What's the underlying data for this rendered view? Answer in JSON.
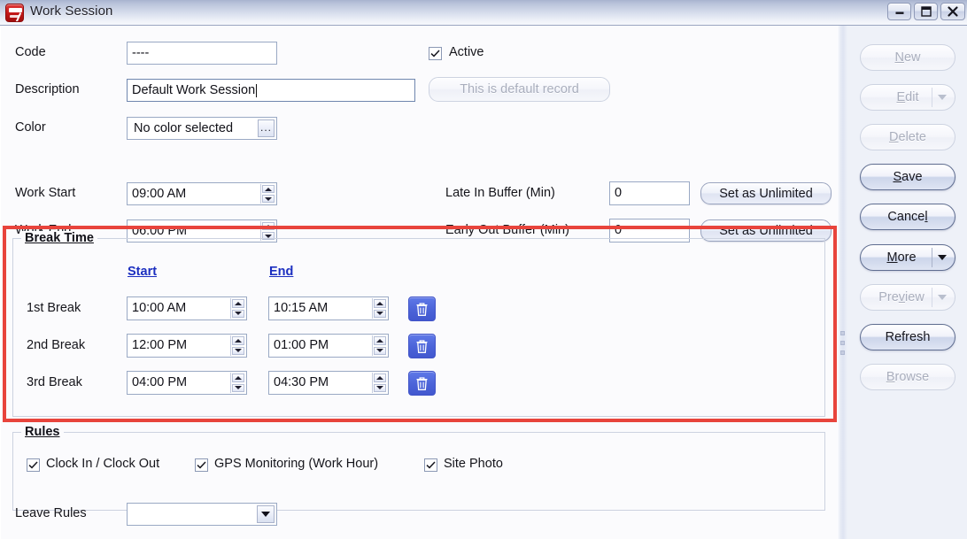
{
  "window": {
    "title": "Work Session",
    "app_icon": "app-logo-icon",
    "controls": {
      "minimize": "minimize-icon",
      "maximize": "maximize-icon",
      "close": "close-icon"
    }
  },
  "form": {
    "fields": {
      "code": {
        "label": "Code",
        "value": "----"
      },
      "description": {
        "label": "Description",
        "value": "Default Work Session"
      },
      "color": {
        "label": "Color",
        "value": "No color selected",
        "browse_label": "..."
      },
      "work_start": {
        "label": "Work Start",
        "value": "09:00 AM"
      },
      "work_end": {
        "label": "Work End",
        "value": "06:00 PM"
      },
      "late_in_buffer": {
        "label": "Late In Buffer (Min)",
        "value": "0",
        "button": "Set as Unlimited"
      },
      "early_out_buffer": {
        "label": "Early Out Buffer (Min)",
        "value": "0",
        "button": "Set as Unlimited"
      }
    },
    "active": {
      "label": "Active",
      "checked": true
    },
    "default_record_button": {
      "label": "This is default record",
      "enabled": false
    }
  },
  "break_time": {
    "title": "Break Time",
    "columns": {
      "start": "Start",
      "end": "End"
    },
    "rows": [
      {
        "label": "1st Break",
        "start": "10:00 AM",
        "end": "10:15 AM",
        "delete": "delete-icon"
      },
      {
        "label": "2nd Break",
        "start": "12:00 PM",
        "end": "01:00 PM",
        "delete": "delete-icon"
      },
      {
        "label": "3rd Break",
        "start": "04:00 PM",
        "end": "04:30 PM",
        "delete": "delete-icon"
      }
    ],
    "highlight_color": "#e8443c"
  },
  "rules": {
    "title": "Rules",
    "items": [
      {
        "label": "Clock In / Clock Out",
        "checked": true
      },
      {
        "label": "GPS Monitoring (Work Hour)",
        "checked": true
      },
      {
        "label": "Site Photo",
        "checked": true
      }
    ]
  },
  "leave_rules": {
    "label": "Leave Rules",
    "value": ""
  },
  "sidebar": {
    "buttons": [
      {
        "id": "new",
        "label": "New",
        "mnemonic": "N",
        "enabled": false,
        "dropdown": false
      },
      {
        "id": "edit",
        "label": "Edit",
        "mnemonic": "E",
        "enabled": false,
        "dropdown": true
      },
      {
        "id": "delete",
        "label": "Delete",
        "mnemonic": "D",
        "enabled": false,
        "dropdown": false
      },
      {
        "id": "save",
        "label": "Save",
        "mnemonic": "S",
        "enabled": true,
        "dropdown": false
      },
      {
        "id": "cancel",
        "label": "Cancel",
        "mnemonic": "l",
        "enabled": true,
        "dropdown": false
      },
      {
        "id": "more",
        "label": "More",
        "mnemonic": "M",
        "enabled": true,
        "dropdown": true
      },
      {
        "id": "preview",
        "label": "Preview",
        "mnemonic": "v",
        "enabled": false,
        "dropdown": true
      },
      {
        "id": "refresh",
        "label": "Refresh",
        "mnemonic": "",
        "enabled": true,
        "dropdown": false
      },
      {
        "id": "browse",
        "label": "Browse",
        "mnemonic": "B",
        "enabled": false,
        "dropdown": false
      }
    ]
  },
  "colors": {
    "titlebar_top": "#a8b3cf",
    "form_bg": "#fbfbfd",
    "sidebar_bg": "#eef1f8",
    "accent_blue": "#4b63d8",
    "link_blue": "#1c2fc0",
    "highlight_red": "#e8443c"
  }
}
